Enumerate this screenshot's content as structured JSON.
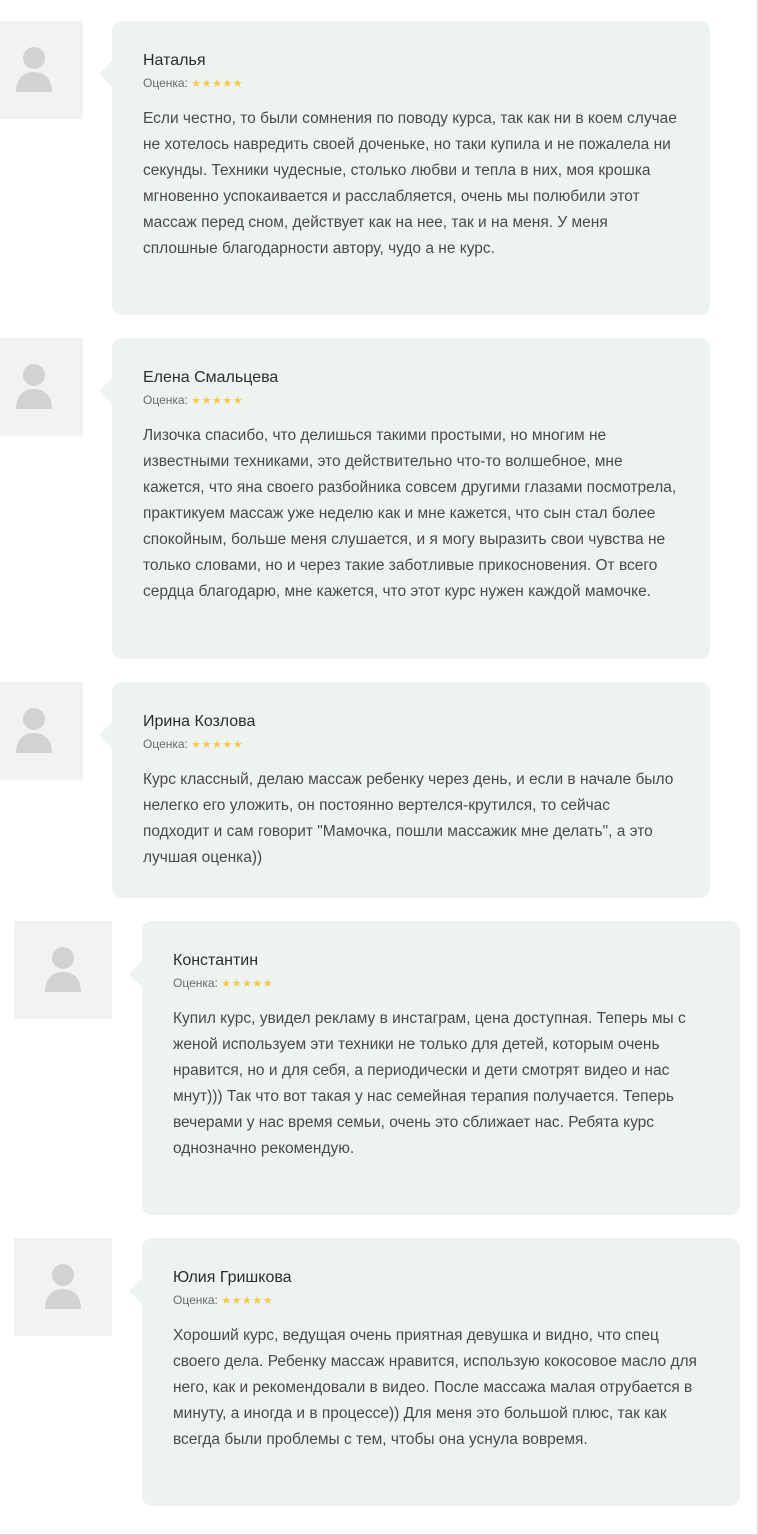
{
  "reviews": [
    {
      "name": "Наталья",
      "rating_label": "Оценка:",
      "stars": "★★★★★",
      "rating_value": 5,
      "text": "Если честно, то были сомнения по поводу курса, так как ни в коем случае не хотелось навредить своей доченьке, но таки купила и не пожалела ни секунды. Техники чудесные, столько любви и тепла в них, моя крошка мгновенно успокаивается и расслабляется, очень мы полюбили этот массаж перед сном, действует как на нее, так и на меня. У меня сплошные благодарности автору, чудо а не курс."
    },
    {
      "name": "Елена Смальцева",
      "rating_label": "Оценка:",
      "stars": "★★★★★",
      "rating_value": 5,
      "text": "Лизочка спасибо, что делишься такими простыми, но многим не известными техниками, это действительно что-то волшебное, мне кажется, что яна своего разбойника совсем другими глазами посмотрела, практикуем массаж уже неделю как и мне кажется, что сын стал более спокойным, больше меня слушается, и я могу выразить свои чувства не только словами, но и через такие заботливые прикосновения. От всего сердца благодарю, мне кажется, что этот курс нужен каждой мамочке."
    },
    {
      "name": "Ирина Козлова",
      "rating_label": "Оценка:",
      "stars": "★★★★★",
      "rating_value": 5,
      "text": "Курс классный, делаю массаж ребенку через день, и если в начале было нелегко его уложить, он постоянно вертелся-крутился, то сейчас подходит и сам говорит \"Мамочка, пошли массажик мне делать\", а это лучшая оценка))"
    },
    {
      "name": "Константин",
      "rating_label": "Оценка:",
      "stars": "★★★★★",
      "rating_value": 5,
      "text": "Купил курс, увидел рекламу в инстаграм, цена доступная. Теперь мы с женой используем эти техники не только для детей, которым очень нравится, но и для себя, а периодически и дети смотрят видео и нас мнут))) Так что вот такая у нас семейная терапия получается. Теперь вечерами у нас время семьи, очень это сближает нас. Ребята курс однозначно рекомендую."
    },
    {
      "name": "Юлия Гришкова",
      "rating_label": "Оценка:",
      "stars": "★★★★★",
      "rating_value": 5,
      "text": "Хороший курс, ведущая очень приятная девушка и видно, что спец своего дела. Ребенку массаж нравится, использую кокосовое масло для него, как и рекомендовали в видео. После массажа малая отрубается в минуту, а иногда и в процессе)) Для меня это большой плюс, так как всегда были проблемы с тем, чтобы она уснула вовремя."
    }
  ],
  "colors": {
    "card_background": "#eef3f0",
    "avatar_background": "#f2f2f2",
    "avatar_icon": "#d2d2d2",
    "stars": "#f2c94c"
  },
  "icons": {
    "avatar": "user-silhouette-icon",
    "rating": "star-icon"
  }
}
